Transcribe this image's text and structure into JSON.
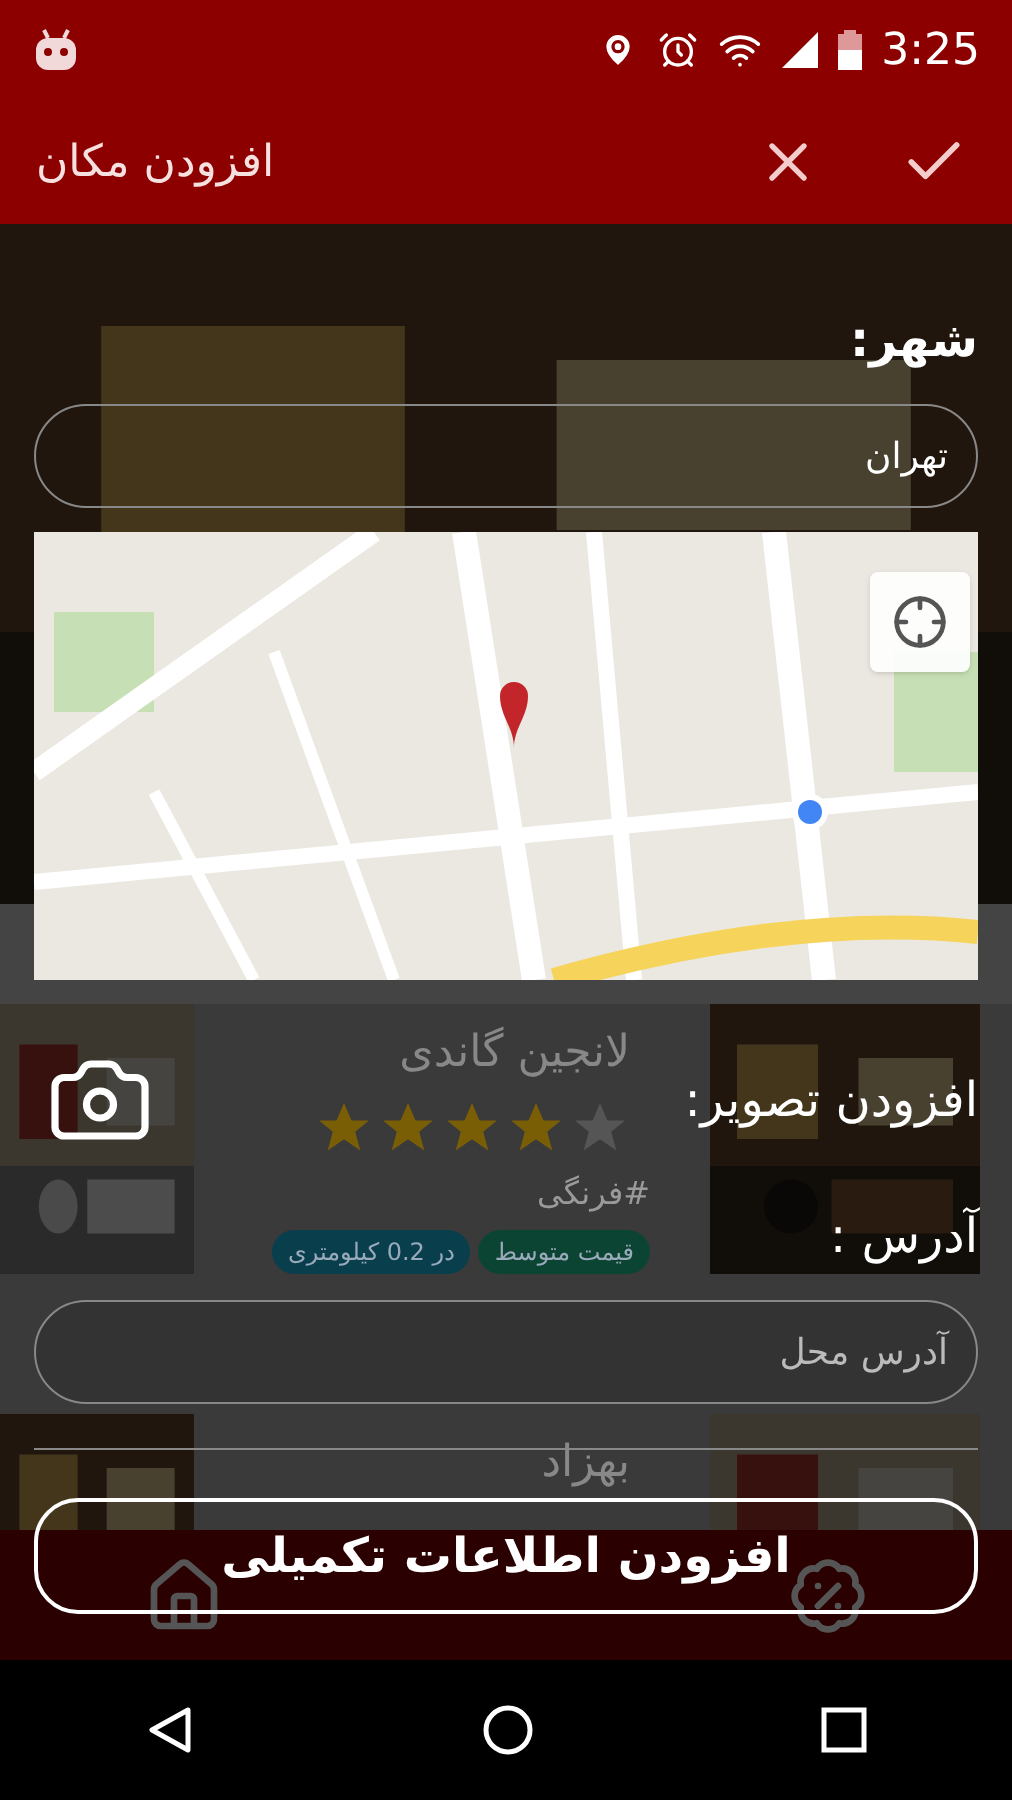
{
  "status_bar": {
    "time": "3:25"
  },
  "app_bar": {
    "title": "افزودن مکان"
  },
  "background_list": {
    "cards": [
      {
        "name": "لانجین گاندی",
        "stars": 4,
        "tag": "#فرنگی",
        "badges": [
          {
            "label": "قیمت متوسط",
            "color": "#0b4433"
          },
          {
            "label": "در 0.2 کیلومتری",
            "color": "#093f4d"
          }
        ]
      },
      {
        "name": "بهزاد"
      }
    ]
  },
  "form": {
    "city_label": "شهر:",
    "city_field": {
      "value": "تهران"
    },
    "image_label": "افزودن تصویر:",
    "address_label": "آدرس :",
    "address_field": {
      "placeholder": "آدرس محل"
    },
    "submit_button": "افزودن اطلاعات تکمیلی"
  }
}
